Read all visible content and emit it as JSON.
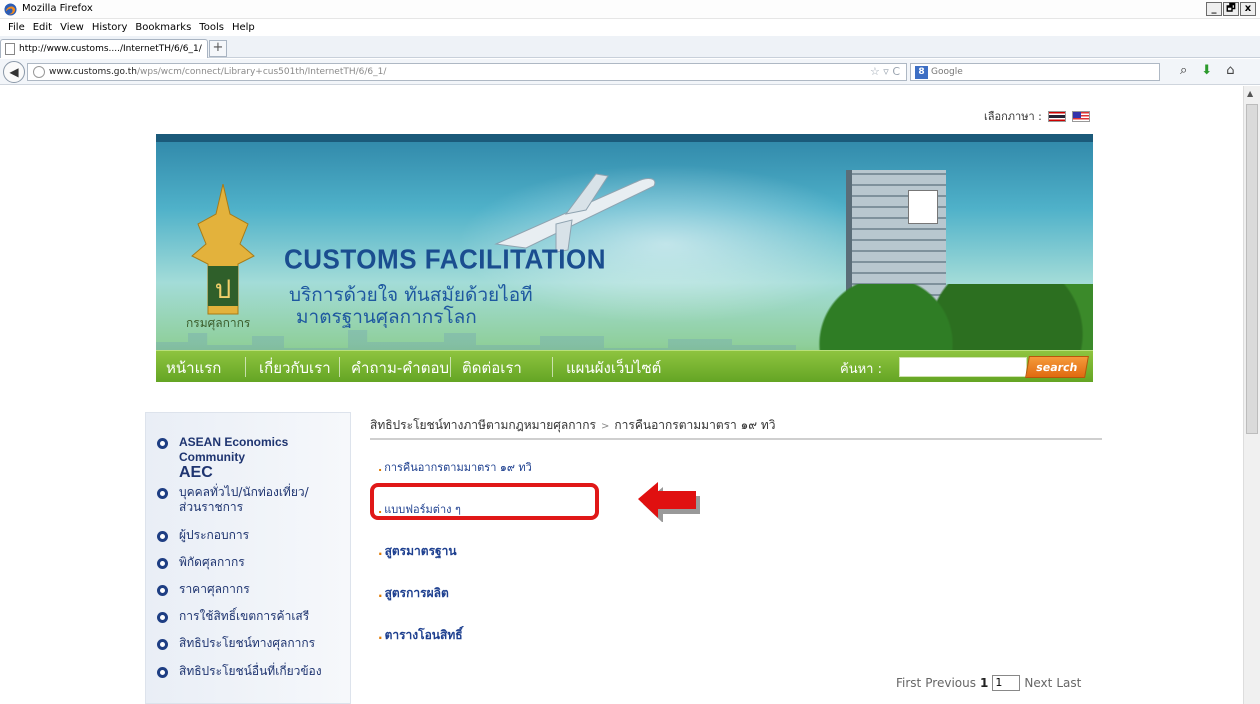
{
  "window": {
    "title": "Mozilla Firefox",
    "controls": [
      "_",
      "🗗",
      "x"
    ]
  },
  "menubar": [
    "File",
    "Edit",
    "View",
    "History",
    "Bookmarks",
    "Tools",
    "Help"
  ],
  "tab": {
    "label": "http://www.customs..../InternetTH/6/6_1/",
    "new_tab": "+"
  },
  "urlbar": {
    "domain": "www.customs.go.th",
    "path": "/wps/wcm/connect/Library+cus501th/InternetTH/6/6_1/"
  },
  "search": {
    "engine_label": "Google"
  },
  "page": {
    "language_label": "เลือกภาษา :",
    "banner": {
      "brand_text": "กรมศุลกากร",
      "headline": "CUSTOMS FACILITATION",
      "subline1": "บริการด้วยใจ ทันสมัยด้วยไอที",
      "subline2": "มาตรฐานศุลกากรโลก"
    },
    "nav": [
      "หน้าแรก",
      "เกี่ยวกับเรา",
      "คำถาม-คำตอบ",
      "ติดต่อเรา",
      "แผนผังเว็บไซต์"
    ],
    "search_label": "ค้นหา :",
    "search_button": "search",
    "sidebar": [
      {
        "line1": "ASEAN Economics Community",
        "line2": "AEC"
      },
      {
        "line1": "บุคคลทั่วไป/นักท่องเที่ยว/",
        "line2": "ส่วนราชการ"
      },
      {
        "line1": "ผู้ประกอบการ"
      },
      {
        "line1": "พิกัดศุลกากร"
      },
      {
        "line1": "ราคาศุลกากร"
      },
      {
        "line1": "การใช้สิทธิ์เขตการค้าเสรี"
      },
      {
        "line1": "สิทธิประโยชน์ทางศุลกากร"
      },
      {
        "line1": "สิทธิประโยชน์อื่นที่เกี่ยวข้อง"
      }
    ],
    "breadcrumb": {
      "parent": "สิทธิประโยชน์ทางภาษีตามกฎหมายศุลกากร",
      "separator": ">",
      "current": "การคืนอากรตามมาตรา ๑๙ ทวิ"
    },
    "links": [
      "การคืนอากรตามมาตรา ๑๙ ทวิ",
      "แบบฟอร์มต่าง ๆ",
      "สูตรมาตรฐาน",
      "สูตรการผลิต",
      "ตารางโอนสิทธิ์"
    ],
    "pager": {
      "first": "First",
      "previous": "Previous",
      "current": "1",
      "input_value": "1",
      "next": "Next",
      "last": "Last"
    }
  }
}
